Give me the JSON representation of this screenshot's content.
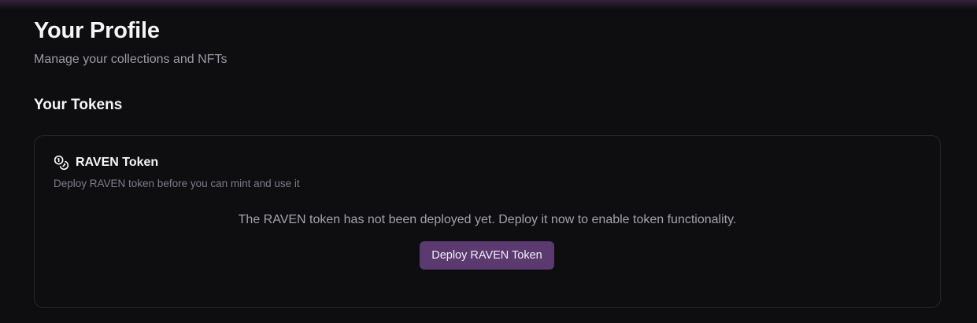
{
  "header": {
    "title": "Your Profile",
    "subtitle": "Manage your collections and NFTs"
  },
  "tokens_section": {
    "title": "Your Tokens",
    "card": {
      "icon": "coins-icon",
      "title": "RAVEN Token",
      "description": "Deploy RAVEN token before you can mint and use it",
      "message": "The RAVEN token has not been deployed yet. Deploy it now to enable token functionality.",
      "button_label": "Deploy RAVEN Token"
    }
  },
  "colors": {
    "background": "#0e0e11",
    "accent_button": "#5b3a70",
    "card_border": "#25252b"
  }
}
